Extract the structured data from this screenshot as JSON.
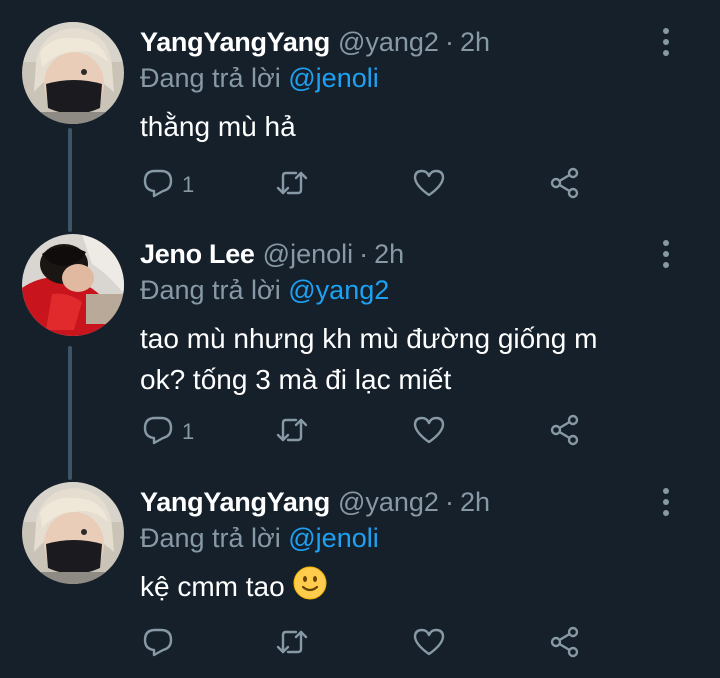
{
  "tweets": [
    {
      "name": "YangYangYang",
      "handle": "@yang2",
      "separator": "·",
      "time": "2h",
      "replying_prefix": "Đang trả lời ",
      "replying_to": "@jenoli",
      "body_lines": [
        "thằng mù hả"
      ],
      "reply_count": "1",
      "avatar_icon": "avatar-light-hair-black-mask"
    },
    {
      "name": "Jeno Lee",
      "handle": "@jenoli",
      "separator": "·",
      "time": "2h",
      "replying_prefix": "Đang trả lời ",
      "replying_to": "@yang2",
      "body_lines": [
        "tao mù nhưng kh mù đường giống m",
        "ok? tống 3 mà đi lạc miết"
      ],
      "reply_count": "1",
      "avatar_icon": "avatar-red-shirt-dark-hair"
    },
    {
      "name": "YangYangYang",
      "handle": "@yang2",
      "separator": "·",
      "time": "2h",
      "replying_prefix": "Đang trả lời ",
      "replying_to": "@jenoli",
      "body_lines": [
        "kệ cmm tao"
      ],
      "body_emoji": "slightly-smiling-face-icon",
      "reply_count": "",
      "avatar_icon": "avatar-light-hair-black-mask"
    }
  ],
  "colors": {
    "background": "#15202b",
    "text": "#ffffff",
    "secondary": "#8899a6",
    "accent": "#1da1f2",
    "thread_line": "#3d5466"
  }
}
